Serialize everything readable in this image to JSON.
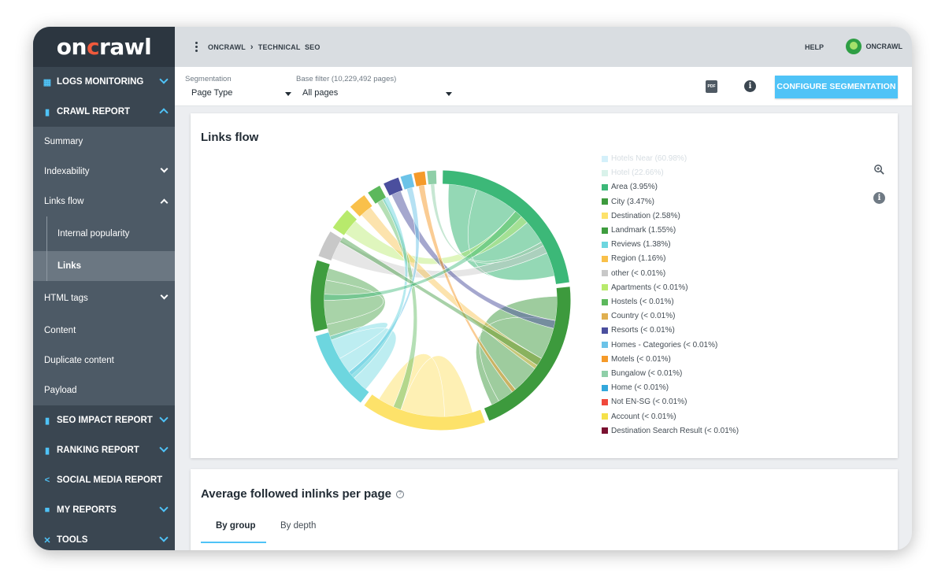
{
  "app": {
    "logo": "oncrawl"
  },
  "topbar": {
    "breadcrumb": [
      "ONCRAWL",
      "TECHNICAL",
      "SEO"
    ],
    "help_label": "HELP",
    "user_label": "ONCRAWL"
  },
  "sidebar": {
    "sections": [
      {
        "label": "LOGS MONITORING",
        "icon": "calendar-icon"
      },
      {
        "label": "CRAWL REPORT",
        "icon": "bar-chart-icon"
      },
      {
        "label": "SEO IMPACT REPORT",
        "icon": "bar-chart-icon"
      },
      {
        "label": "RANKING REPORT",
        "icon": "bar-chart-icon"
      },
      {
        "label": "SOCIAL MEDIA REPORT",
        "icon": "share-icon"
      },
      {
        "label": "MY REPORTS",
        "icon": "folder-icon"
      },
      {
        "label": "TOOLS",
        "icon": "tools-icon"
      }
    ],
    "crawl_items": [
      "Summary",
      "Indexability",
      "Links flow",
      "HTML tags",
      "Content",
      "Duplicate content",
      "Payload"
    ],
    "links_flow_items": [
      "Internal popularity",
      "Links"
    ]
  },
  "filters": {
    "segmentation_label": "Segmentation",
    "segmentation_value": "Page Type",
    "base_filter_label": "Base filter (10,229,492 pages)",
    "base_filter_value": "All pages",
    "configure_label": "CONFIGURE SEGMENTATION"
  },
  "links_flow_card": {
    "title": "Links flow",
    "legend": [
      {
        "label": "Hotels Near (60.98%)",
        "color": "#b8e6f7",
        "dim": true
      },
      {
        "label": "Hotel (22.66%)",
        "color": "#bfe9dc",
        "dim": true
      },
      {
        "label": "Area (3.95%)",
        "color": "#3cb878"
      },
      {
        "label": "City (3.47%)",
        "color": "#3d9a3d"
      },
      {
        "label": "Destination (2.58%)",
        "color": "#fde26a"
      },
      {
        "label": "Landmark (1.55%)",
        "color": "#3f9d3f"
      },
      {
        "label": "Reviews (1.38%)",
        "color": "#6dd6df"
      },
      {
        "label": "Region (1.16%)",
        "color": "#f9c04a"
      },
      {
        "label": "other (< 0.01%)",
        "color": "#c8c8c8"
      },
      {
        "label": "Apartments (< 0.01%)",
        "color": "#b8ea6c"
      },
      {
        "label": "Hostels (< 0.01%)",
        "color": "#5cb85c"
      },
      {
        "label": "Country (< 0.01%)",
        "color": "#e0b050"
      },
      {
        "label": "Resorts (< 0.01%)",
        "color": "#4b4f9e"
      },
      {
        "label": "Homes - Categories (< 0.01%)",
        "color": "#6cc3e8"
      },
      {
        "label": "Motels (< 0.01%)",
        "color": "#f59a2a"
      },
      {
        "label": "Bungalow (< 0.01%)",
        "color": "#8fcfa8"
      },
      {
        "label": "Home (< 0.01%)",
        "color": "#33a8dc"
      },
      {
        "label": "Not EN-SG (< 0.01%)",
        "color": "#f0483c"
      },
      {
        "label": "Account (< 0.01%)",
        "color": "#f5e14a"
      },
      {
        "label": "Destination Search Result (< 0.01%)",
        "color": "#7a1030"
      }
    ]
  },
  "inlinks_card": {
    "title": "Average followed inlinks per page",
    "tabs": [
      "By group",
      "By depth"
    ]
  }
}
